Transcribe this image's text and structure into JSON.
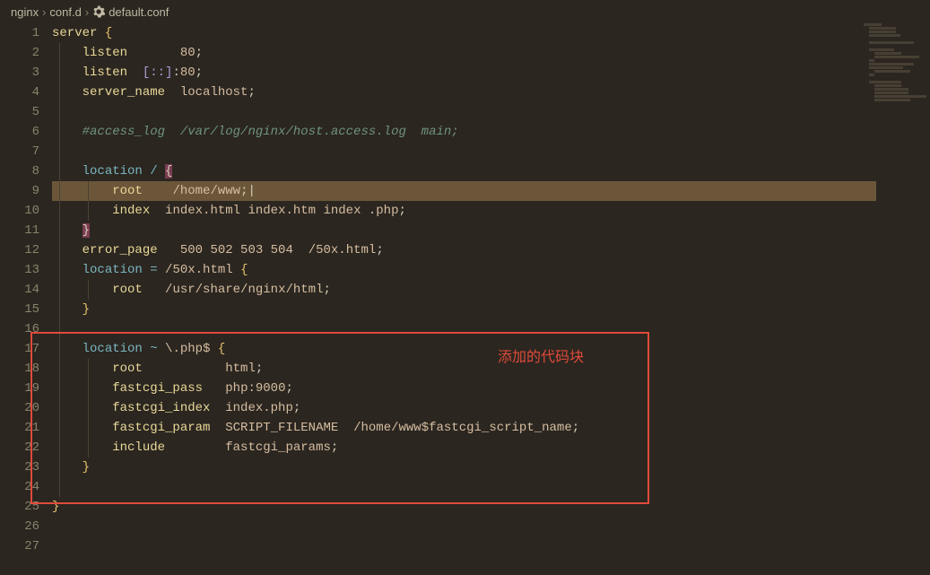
{
  "breadcrumb": {
    "seg1": "nginx",
    "seg2": "conf.d",
    "seg3": "default.conf"
  },
  "annotation": {
    "label": "添加的代码块"
  },
  "editor": {
    "highlightedLine": 9,
    "redBox": {
      "fromLine": 16,
      "toLine": 24
    },
    "lineCount": 27,
    "code": {
      "l1": "server {",
      "l2": "    listen       80;",
      "l3": "    listen  [::]:80;",
      "l4": "    server_name  localhost;",
      "l5": "",
      "l6": "    #access_log  /var/log/nginx/host.access.log  main;",
      "l7": "",
      "l8": "    location / {",
      "l9": "        root    /home/www;",
      "l10": "        index  index.html index.htm index .php;",
      "l11": "    }",
      "l12": "    error_page   500 502 503 504  /50x.html;",
      "l13": "    location = /50x.html {",
      "l14": "        root   /usr/share/nginx/html;",
      "l15": "    }",
      "l16": "",
      "l17": "    location ~ \\.php$ {",
      "l18": "        root           html;",
      "l19": "        fastcgi_pass   php:9000;",
      "l20": "        fastcgi_index  index.php;",
      "l21": "        fastcgi_param  SCRIPT_FILENAME  /home/www$fastcgi_script_name;",
      "l22": "        include        fastcgi_params;",
      "l23": "    }",
      "l24": "",
      "l25": "}",
      "l26": "",
      "l27": ""
    }
  }
}
